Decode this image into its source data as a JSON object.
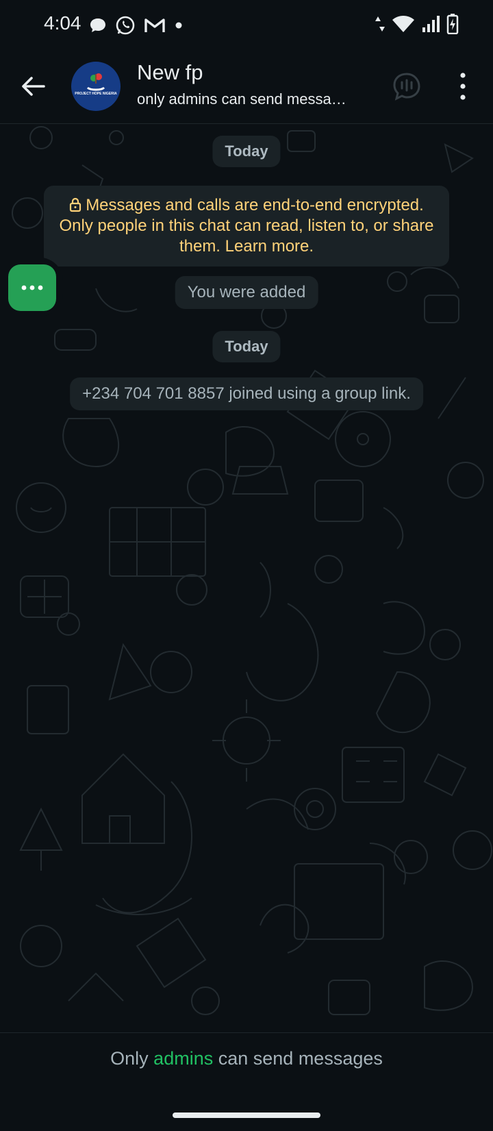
{
  "status_bar": {
    "time": "4:04",
    "left_icons": [
      "chat-bubble-icon",
      "whatsapp-icon",
      "gmail-icon",
      "dot-icon"
    ],
    "right_icons": [
      "data-arrows-icon",
      "wifi-icon",
      "signal-icon",
      "battery-charging-icon"
    ]
  },
  "header": {
    "title": "New fp",
    "subtitle": "only admins can send messa…",
    "avatar_text": "PROJECT HOPE NIGERIA"
  },
  "chat": {
    "date_chip_1": "Today",
    "encryption_notice": "Messages and calls are end-to-end encrypted. Only people in this chat can read, listen to, or share them. Learn more.",
    "added_notice": "You were added",
    "date_chip_2": "Today",
    "join_notice": "+234 704 701 8857 joined using a group link."
  },
  "footer": {
    "prefix": "Only",
    "highlight": "admins",
    "suffix": "can send messages"
  },
  "colors": {
    "background": "#0b1014",
    "bubble": "#1a2226",
    "accent_green": "#21c063",
    "encryption_text": "#ffd279"
  }
}
